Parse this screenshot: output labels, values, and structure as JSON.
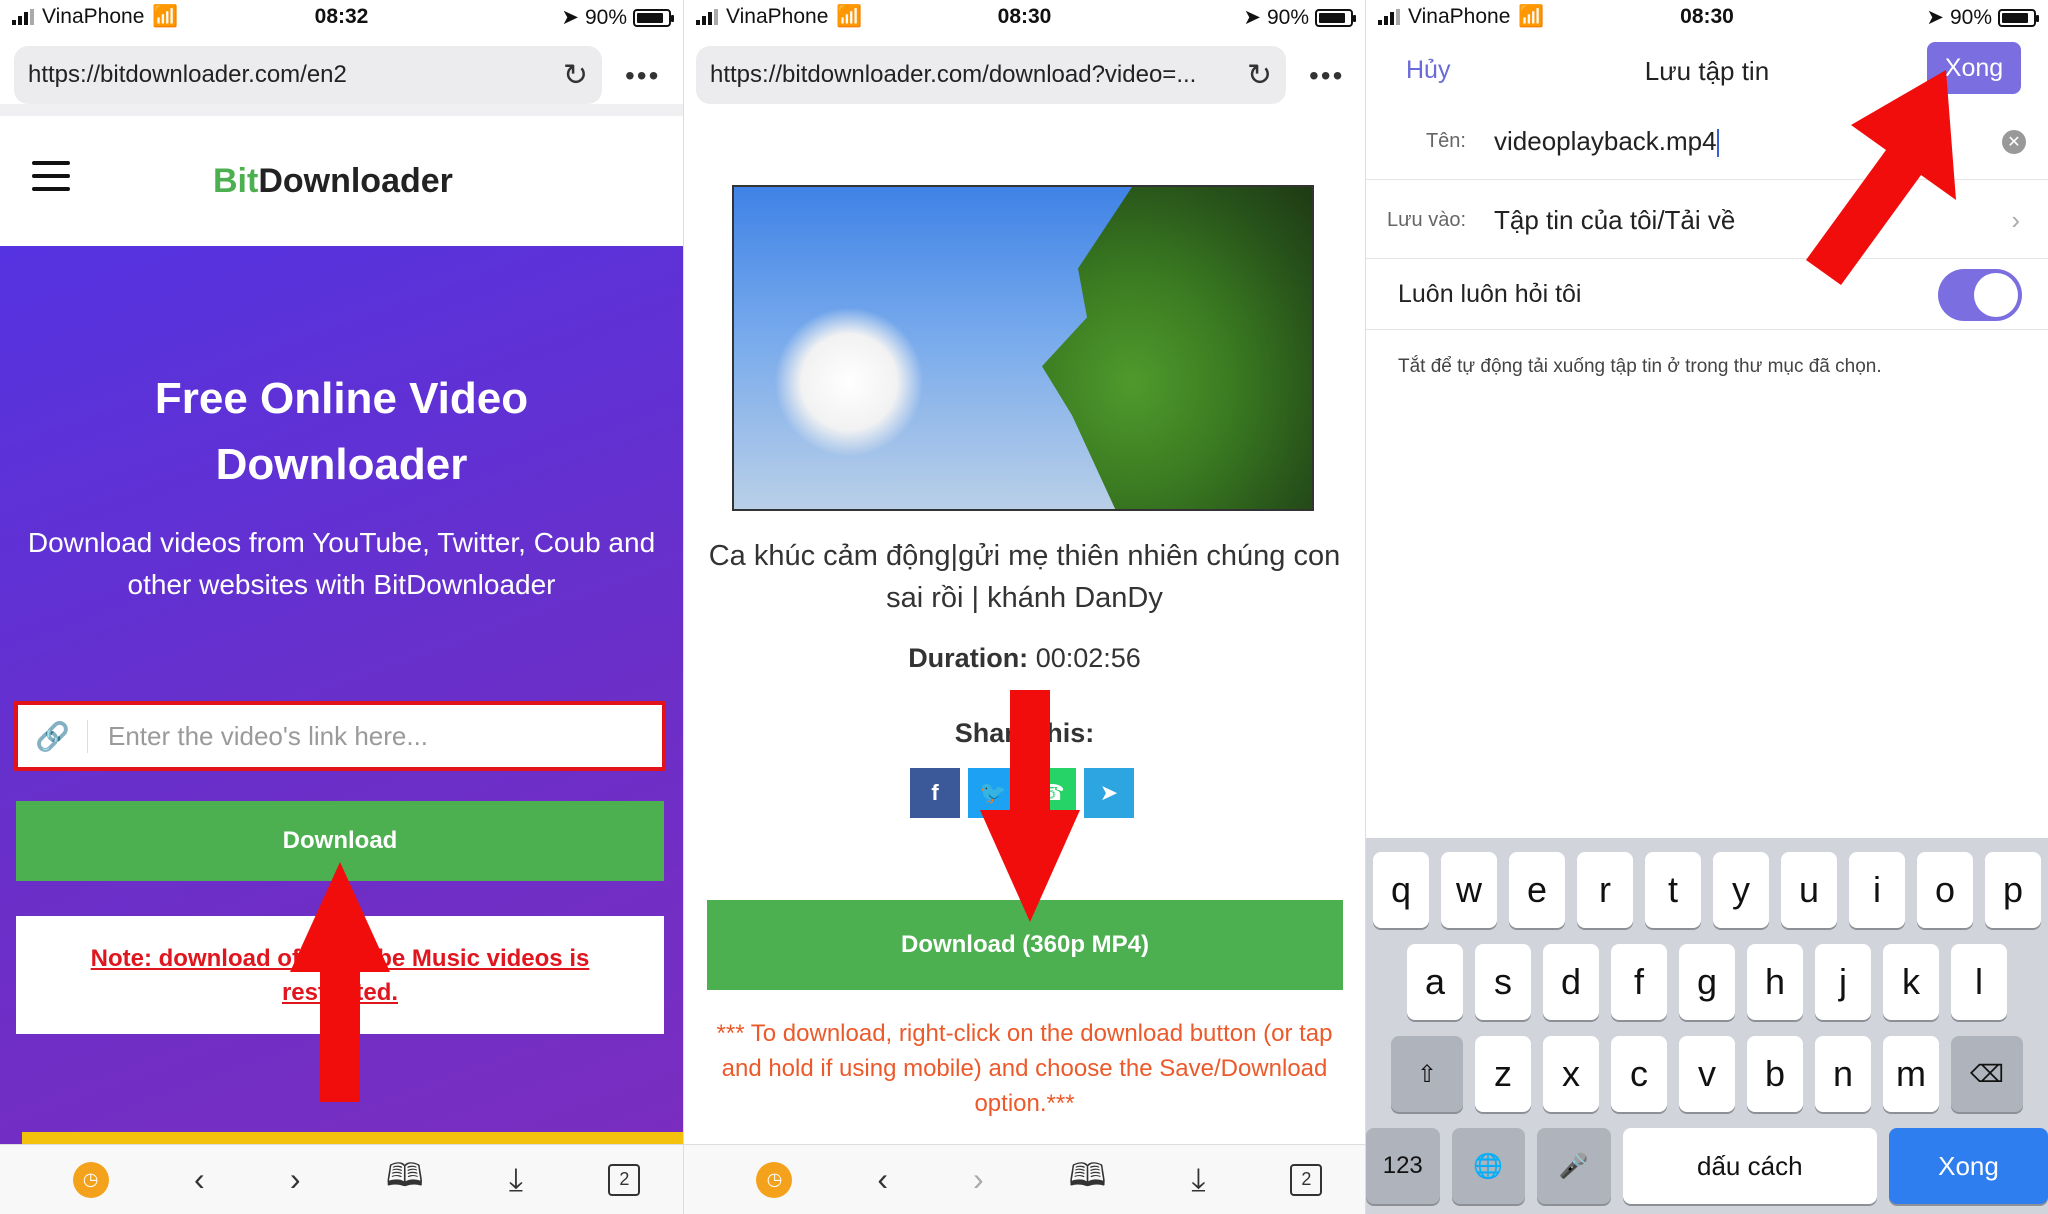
{
  "status": {
    "carrier": "VinaPhone",
    "battery": "90%",
    "times": [
      "08:32",
      "08:30",
      "08:30"
    ]
  },
  "panel1": {
    "url": "https://bitdownloader.com/en2",
    "logo_accent": "Bit",
    "logo_rest": "Downloader",
    "hero_title": "Free Online Video Downloader",
    "hero_sub": "Download videos from YouTube, Twitter, Coub and other websites with BitDownloader",
    "input_placeholder": "Enter the video's link here...",
    "download_label": "Download",
    "note": "Note: download of YouTube Music videos is restricted."
  },
  "panel2": {
    "url": "https://bitdownloader.com/download?video=...",
    "video_title": "Ca khúc cảm động|gửi mẹ thiên nhiên chúng con sai rồi | khánh DanDy",
    "duration_label": "Duration:",
    "duration_value": "00:02:56",
    "share_label": "Share this:",
    "download_label": "Download (360p MP4)",
    "instructions": "*** To download, right-click on the download button (or tap and hold if using mobile) and choose the Save/Download option.***"
  },
  "panel3": {
    "cancel": "Hủy",
    "title": "Lưu tập tin",
    "done": "Xong",
    "name_label": "Tên:",
    "name_value": "videoplayback.mp4",
    "save_label": "Lưu vào:",
    "save_value": "Tập tin của tôi/Tải về",
    "always_ask": "Luôn luôn hỏi tôi",
    "always_ask_on": true,
    "hint": "Tắt để tự động tải xuống tập tin ở trong thư mục đã chọn.",
    "keyboard": {
      "row1": [
        "q",
        "w",
        "e",
        "r",
        "t",
        "y",
        "u",
        "i",
        "o",
        "p"
      ],
      "row2": [
        "a",
        "s",
        "d",
        "f",
        "g",
        "h",
        "j",
        "k",
        "l"
      ],
      "row3": [
        "z",
        "x",
        "c",
        "v",
        "b",
        "n",
        "m"
      ],
      "numbers": "123",
      "space": "dấu cách",
      "return": "Xong"
    }
  },
  "toolbar": {
    "tabs_count": "2"
  },
  "colors": {
    "green": "#4caf50",
    "red": "#e2121b",
    "purple": "#6a2fc9",
    "accent": "#7b6ee0"
  }
}
